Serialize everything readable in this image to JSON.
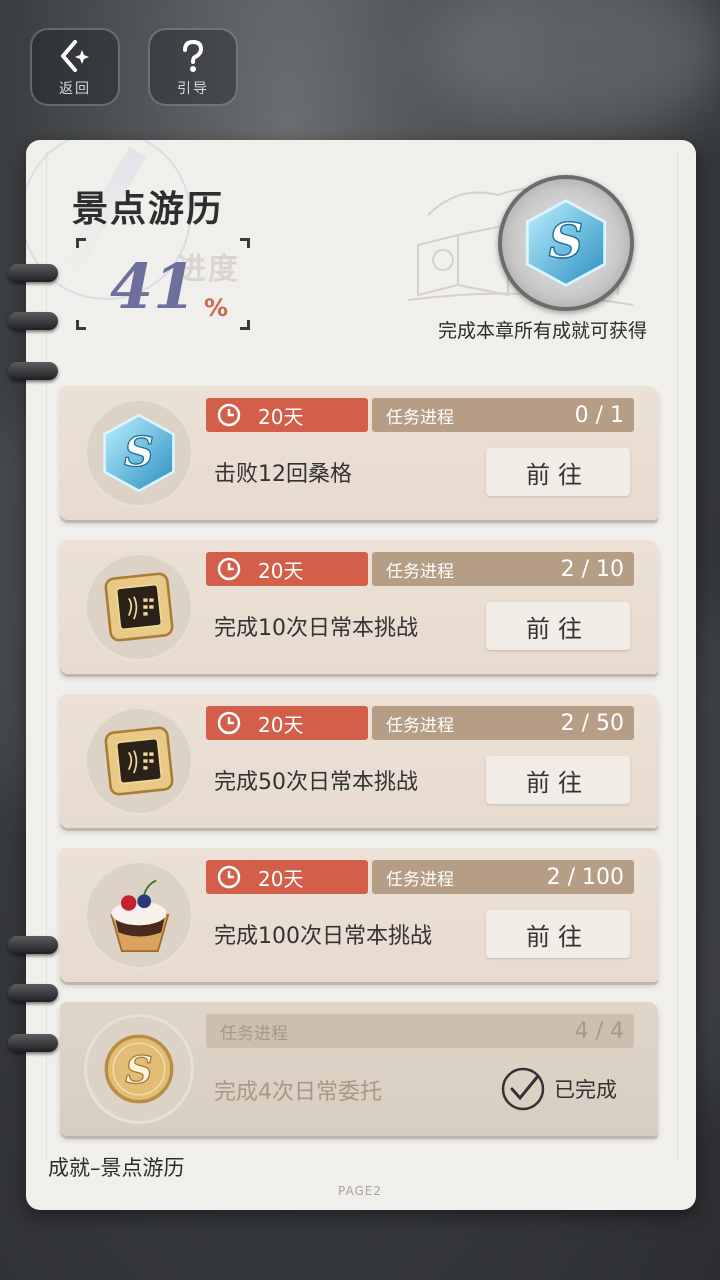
{
  "top_buttons": {
    "back_label": "返回",
    "guide_label": "引导"
  },
  "header": {
    "title": "景点游历",
    "progress_label": "进度",
    "progress_value": "41",
    "progress_unit": "%",
    "reward_caption": "完成本章所有成就可获得",
    "reward_icon": "s-crystal-badge-icon"
  },
  "tasks": [
    {
      "icon": "s-crystal-icon",
      "timer": "20天",
      "progress_label": "任务进程",
      "progress": "0 / 1",
      "text": "击败12回桑格",
      "action": "前往",
      "done": false
    },
    {
      "icon": "gold-chip-icon",
      "timer": "20天",
      "progress_label": "任务进程",
      "progress": "2 / 10",
      "text": "完成10次日常本挑战",
      "action": "前往",
      "done": false
    },
    {
      "icon": "gold-chip-icon",
      "timer": "20天",
      "progress_label": "任务进程",
      "progress": "2 / 50",
      "text": "完成50次日常本挑战",
      "action": "前往",
      "done": false
    },
    {
      "icon": "berry-tart-icon",
      "timer": "20天",
      "progress_label": "任务进程",
      "progress": "2 / 100",
      "text": "完成100次日常本挑战",
      "action": "前往",
      "done": false
    },
    {
      "icon": "gold-s-coin-icon",
      "progress_label": "任务进程",
      "progress": "4 / 4",
      "text": "完成4次日常委托",
      "status": "已完成",
      "done": true
    }
  ],
  "footer": {
    "title": "成就–景点游历",
    "page": "PAGE2"
  },
  "colors": {
    "timer_red": "#d35f4a",
    "progress_tan": "#b69d86",
    "percent_accent": "#6d6f9d"
  }
}
